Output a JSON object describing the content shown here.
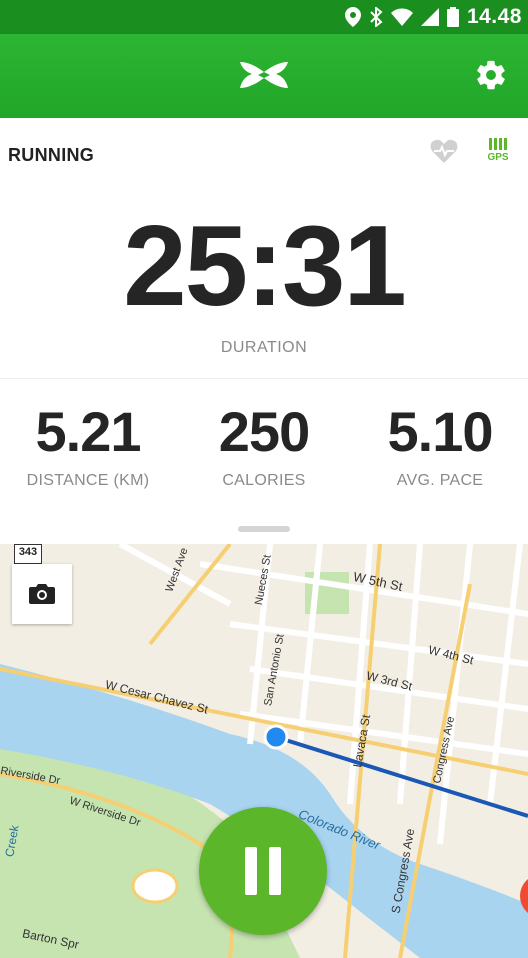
{
  "status_bar": {
    "time": "14.48",
    "icons": [
      "location-icon",
      "bluetooth-icon",
      "wifi-icon",
      "signal-icon",
      "battery-icon"
    ]
  },
  "app_bar": {
    "logo": "under-armour-logo",
    "settings_icon": "gear-icon",
    "color": "#22a629"
  },
  "activity": {
    "type": "RUNNING",
    "gps_label": "GPS"
  },
  "duration": {
    "value": "25:31",
    "label": "DURATION"
  },
  "stats": [
    {
      "value": "5.21",
      "label": "DISTANCE (KM)"
    },
    {
      "value": "250",
      "label": "CALORIES"
    },
    {
      "value": "5.10",
      "label": "AVG. PACE"
    }
  ],
  "map": {
    "route_shield": "343",
    "street_labels": [
      "W 5th St",
      "W 4th St",
      "W 3rd St",
      "W Cesar Chavez St",
      "Nueces St",
      "San Antonio St",
      "West Ave",
      "Lavaca St",
      "Congress Ave",
      "S Congress Ave",
      "W Riverside Dr",
      "Riverside Dr",
      "Colorado River",
      "Creek",
      "Barton Spr"
    ],
    "water_color": "#a8d4f0",
    "park_color": "#c6e4b0"
  },
  "controls": {
    "pause_color": "#5cb62a"
  }
}
